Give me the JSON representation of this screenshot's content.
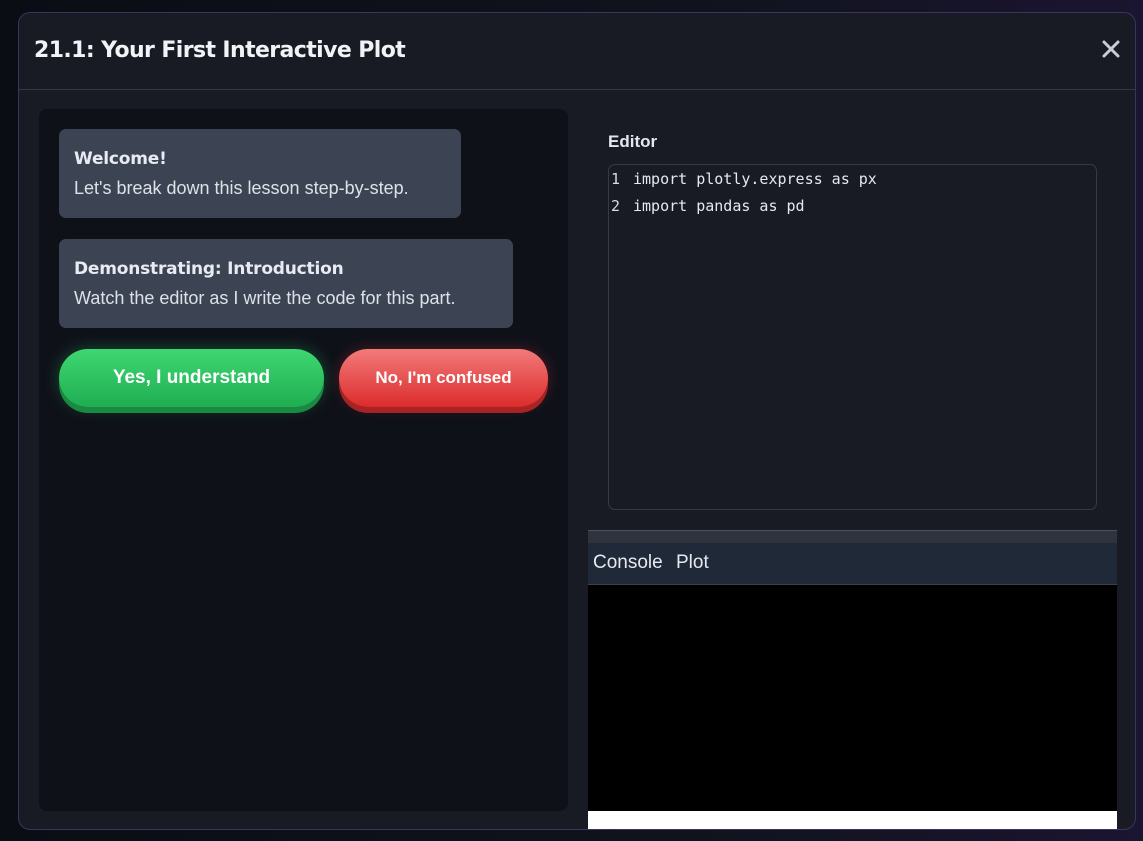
{
  "modal": {
    "title": "21.1: Your First Interactive Plot",
    "close_icon": "close-icon"
  },
  "chat": {
    "messages": [
      {
        "title": "Welcome!",
        "text": "Let's break down this lesson step-by-step."
      },
      {
        "title": "Demonstrating: Introduction",
        "text": "Watch the editor as I write the code for this part."
      }
    ],
    "yes_label": "Yes, I understand",
    "no_label": "No, I'm confused"
  },
  "editor": {
    "label": "Editor",
    "lines": [
      {
        "number": "1",
        "code": "import plotly.express as px"
      },
      {
        "number": "2",
        "code": "import pandas as pd"
      }
    ]
  },
  "output": {
    "tabs": [
      {
        "label": "Console"
      },
      {
        "label": "Plot"
      }
    ]
  },
  "colors": {
    "yes_button": "#22c55e",
    "no_button": "#ef4444",
    "modal_bg": "#181b24",
    "chat_bg": "#0f1119",
    "bubble_bg": "#3c4453",
    "console_bg": "#000000"
  }
}
